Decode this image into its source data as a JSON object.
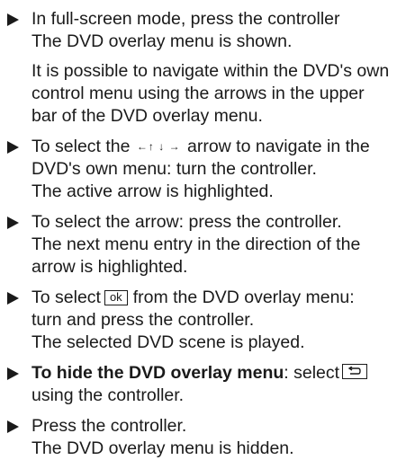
{
  "steps": [
    {
      "lines": [
        "In full-screen mode, press the controller",
        "The DVD overlay menu is shown."
      ]
    },
    {
      "paragraph": [
        "It is possible to navigate within the DVD's own",
        "control menu using the arrows in the upper",
        "bar of the DVD overlay menu."
      ]
    },
    {
      "line1_before": "To select the",
      "arrows": "←↑ ↓ →",
      "line1_after": "arrow to navigate in the",
      "lines": [
        "DVD's own menu: turn the controller.",
        "The active arrow is highlighted."
      ]
    },
    {
      "lines": [
        "To select the arrow: press the controller.",
        "The next menu entry in the direction of the",
        "arrow is highlighted."
      ]
    },
    {
      "line1_before": "To select",
      "ok_label": "ok",
      "line1_after": "from the DVD overlay menu:",
      "lines": [
        "turn and press the controller.",
        "The selected DVD scene is played."
      ]
    },
    {
      "bold": "To hide the DVD overlay menu",
      "after_bold": ": select",
      "lines": [
        "using the controller."
      ],
      "icon": "back-icon"
    },
    {
      "lines": [
        "Press the controller.",
        "The DVD overlay menu is hidden."
      ]
    }
  ]
}
